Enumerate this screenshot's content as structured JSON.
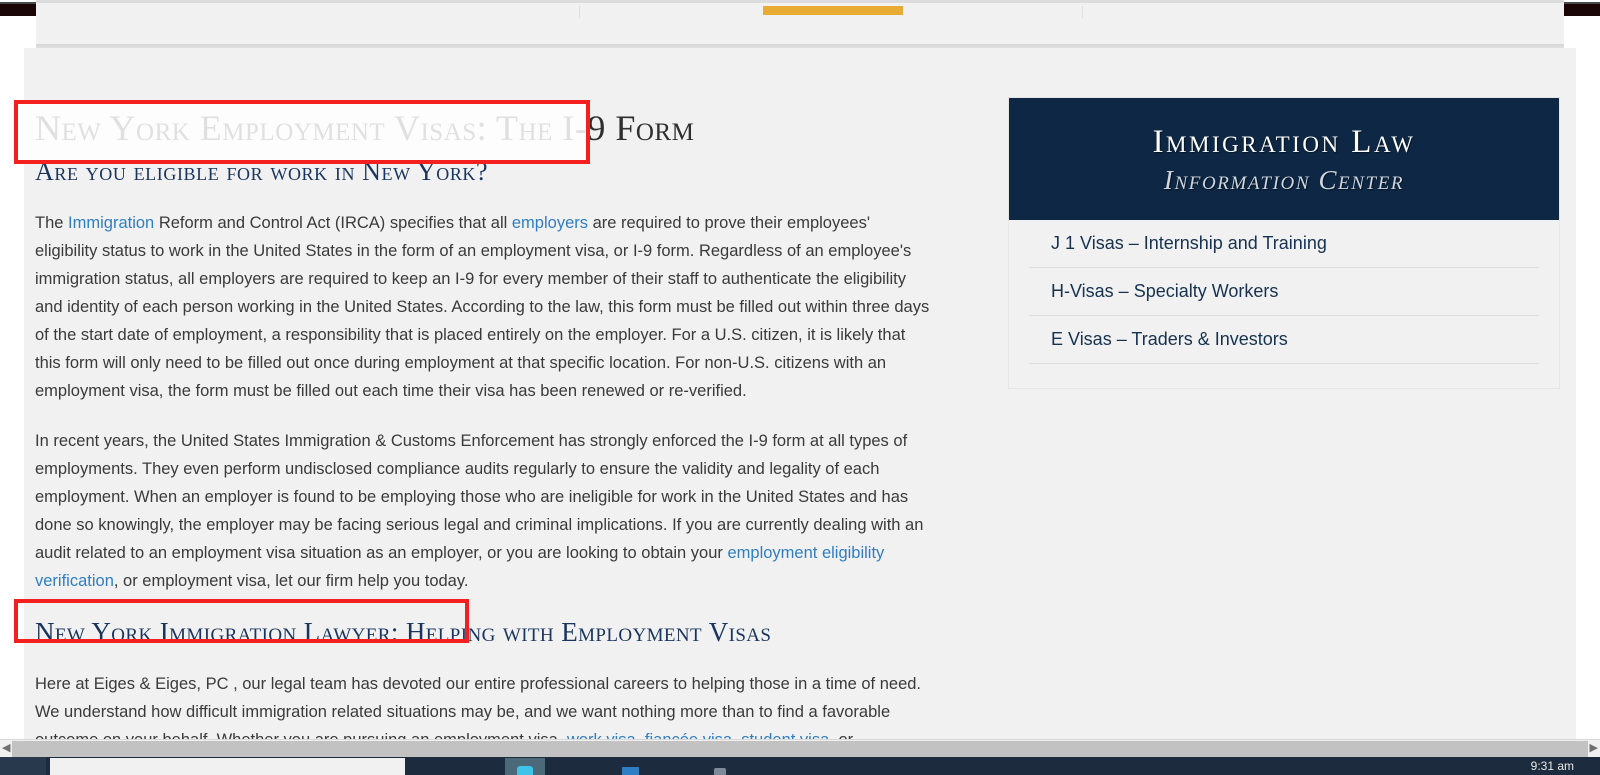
{
  "browser": {
    "nav_active_indicator_color": "#e8ab33"
  },
  "article": {
    "title_main": "New York Employment Visas:",
    "title_rest": " The I-9 Form",
    "subtitle": "Are you eligible for work in New York?",
    "paragraph1": {
      "part1": "The ",
      "link1": "Immigration",
      "part2": " Reform and Control Act (IRCA) specifies that all ",
      "link2": "employers",
      "part3": " are required to prove their employees' eligibility status to work in the United States in the form of an employment visa, or I-9 form. Regardless of an employee's immigration status, all employers are required to keep an I-9 for every member of their staff to authenticate the eligibility and identity of each person working in the United States. According to the law, this form must be filled out within three days of the start date of employment, a responsibility that is placed entirely on the employer. For a U.S. citizen, it is likely that this form will only need to be filled out once during employment at that specific location. For non-U.S. citizens with an employment visa, the form must be filled out each time their visa has been renewed or re-verified."
    },
    "paragraph2": {
      "part1": "In recent years, the United States Immigration & Customs Enforcement has strongly enforced the I-9 form at all types of employments. They even perform undisclosed compliance audits regularly to ensure the validity and legality of each employment. When an employer is found to be employing those who are ineligible for work in the United States and has done so knowingly, the employer may be facing serious legal and criminal implications. If you are currently dealing with an audit related to an employment visa situation as an employer, or you are looking to obtain your ",
      "link1": "employment eligibility verification",
      "part2": ", or employment visa, let our firm help you today."
    },
    "section_title_main": "New York Immigration Lawyer:",
    "section_title_rest": " Helping with Employment Visas",
    "paragraph3": {
      "part1": "Here at Eiges & Eiges, PC , our legal team has devoted our entire professional careers to helping those in a time of need. We understand how difficult immigration related situations may be, and we want nothing more than to find a favorable outcome on your behalf. Whether you are pursuing an employment visa, ",
      "link1": "work visa",
      "sep1": ", ",
      "link2": "fiancée visa",
      "sep2": ", ",
      "link3": "student visa",
      "part2": ", or"
    }
  },
  "sidebar": {
    "header_line1": "Immigration Law",
    "header_line2": "Information Center",
    "header_bg": "#0d2744",
    "items": [
      {
        "label": "J 1 Visas – Internship and Training"
      },
      {
        "label": "H-Visas – Specialty Workers"
      },
      {
        "label": "E Visas – Traders & Investors"
      }
    ]
  },
  "annotations": {
    "box_color": "#f41f1f",
    "box1_target": "New York Employment Visas:",
    "box2_target": "New York Immigration Lawyer:"
  },
  "scrollbar": {
    "left_arrow": "◀",
    "right_arrow": "▶"
  },
  "taskbar": {
    "clock": "9:31 am"
  }
}
